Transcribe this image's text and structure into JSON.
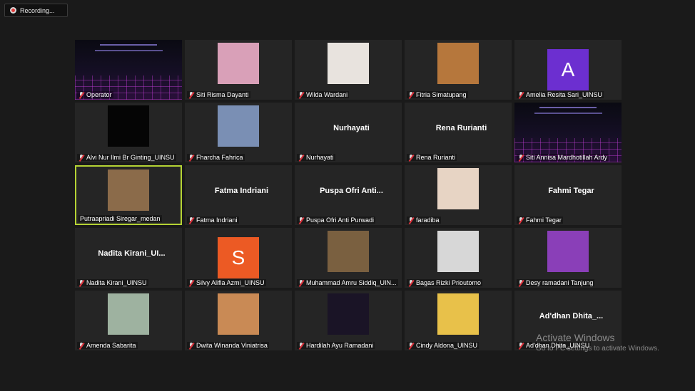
{
  "recording": {
    "label": "Recording..."
  },
  "tiles": [
    {
      "label": "Operator",
      "type": "screen"
    },
    {
      "label": "Siti Risma Dayanti",
      "type": "photo",
      "color": "#d9a0b8"
    },
    {
      "label": "Wilda Wardani",
      "type": "photo",
      "color": "#e8e3de"
    },
    {
      "label": "Fitria Simatupang",
      "type": "photo",
      "color": "#b6773c"
    },
    {
      "label": "Amelia Resita Sari_UINSU",
      "type": "initial",
      "initial": "A",
      "color": "#6c2fd0"
    },
    {
      "label": "Alvi Nur Ilmi Br Ginting_UINSU",
      "type": "photo",
      "color": "#050505"
    },
    {
      "label": "Fharcha Fahrica",
      "type": "photo",
      "color": "#7a8fb4"
    },
    {
      "label": "Nurhayati",
      "type": "name",
      "name": "Nurhayati"
    },
    {
      "label": "Rena Rurianti",
      "type": "name",
      "name": "Rena Rurianti"
    },
    {
      "label": "Siti Annisa Mardhotillah Ardy",
      "type": "screen"
    },
    {
      "label": "Putraapriadi Siregar_medan",
      "type": "photo",
      "color": "#8b6b4a",
      "active": true
    },
    {
      "label": "Fatma Indriani",
      "type": "name",
      "name": "Fatma Indriani"
    },
    {
      "label": "Puspa Ofri Anti Purwadi",
      "type": "name",
      "name": "Puspa  Ofri  Anti..."
    },
    {
      "label": "faradiba",
      "type": "photo",
      "color": "#e7d4c4"
    },
    {
      "label": "Fahmi Tegar",
      "type": "name",
      "name": "Fahmi Tegar"
    },
    {
      "label": "Nadita Kirani_UINSU",
      "type": "name",
      "name": "Nadita  Kirani_UI..."
    },
    {
      "label": "Silvy Alifia Azmi_UINSU",
      "type": "initial",
      "initial": "S",
      "color": "#ec5a24"
    },
    {
      "label": "Muhammad Amru Siddiq_UIN...",
      "type": "photo",
      "color": "#7a6040"
    },
    {
      "label": "Bagas Rizki Prioutomo",
      "type": "photo",
      "color": "#d7d7d7"
    },
    {
      "label": "Desy ramadani Tanjung",
      "type": "photo",
      "color": "#8a3fb8"
    },
    {
      "label": "Amenda Sabarita",
      "type": "photo",
      "color": "#9eb2a0"
    },
    {
      "label": "Dwita Winanda Viniatrisa",
      "type": "photo",
      "color": "#c98a55"
    },
    {
      "label": "Hardilah Ayu Ramadani",
      "type": "photo",
      "color": "#1a1426"
    },
    {
      "label": "Cindy Aldona_UINSU",
      "type": "photo",
      "color": "#e8c14a"
    },
    {
      "label": "Ad'dhan Dhita_UINSU",
      "type": "name",
      "name": "Ad'dhan  Dhita_..."
    }
  ],
  "watermark": {
    "title": "Activate Windows",
    "subtitle": "Go to PC settings to activate Windows."
  }
}
